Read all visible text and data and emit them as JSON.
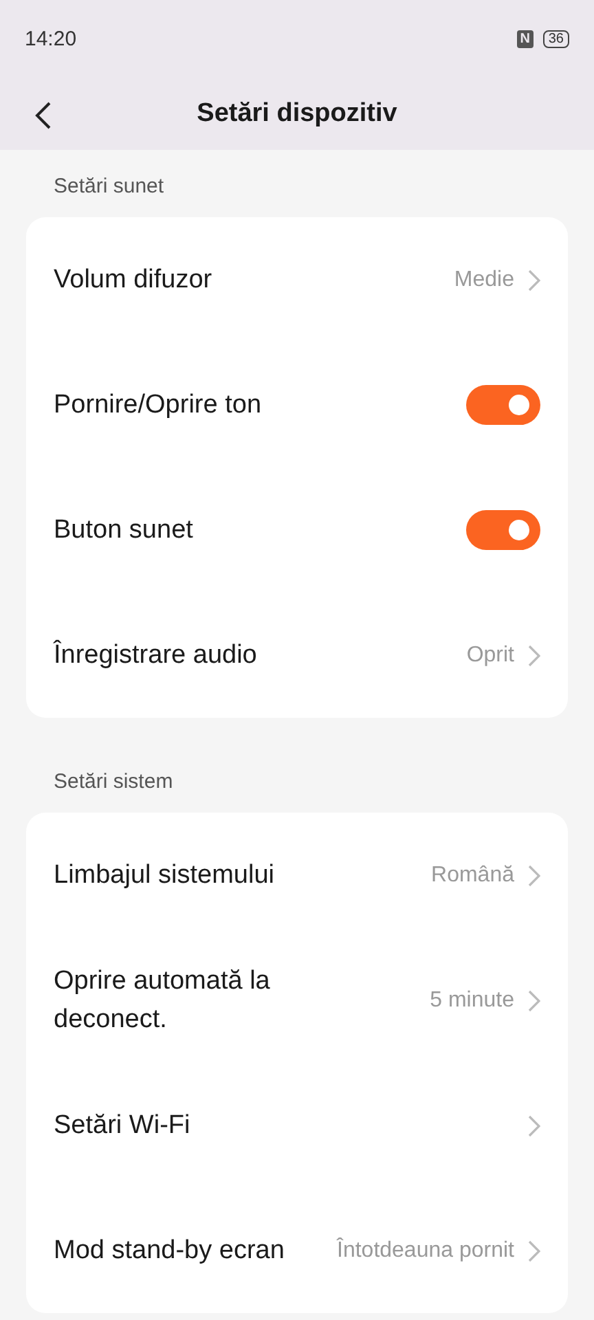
{
  "status_bar": {
    "time": "14:20",
    "nfc": "N",
    "battery": "36"
  },
  "header": {
    "title": "Setări dispozitiv"
  },
  "sections": [
    {
      "title": "Setări sunet",
      "rows": [
        {
          "kind": "value",
          "label": "Volum difuzor",
          "value": "Medie"
        },
        {
          "kind": "toggle",
          "label": "Pornire/Oprire ton",
          "on": true
        },
        {
          "kind": "toggle",
          "label": "Buton sunet",
          "on": true
        },
        {
          "kind": "value",
          "label": "Înregistrare audio",
          "value": "Oprit"
        }
      ]
    },
    {
      "title": "Setări sistem",
      "rows": [
        {
          "kind": "value",
          "label": "Limbajul sistemului",
          "value": "Română"
        },
        {
          "kind": "value",
          "label": "Oprire automată la deconect.",
          "value": "5 minute"
        },
        {
          "kind": "link",
          "label": "Setări Wi-Fi"
        },
        {
          "kind": "value",
          "label": "Mod stand-by ecran",
          "value": "Întotdeauna pornit"
        }
      ]
    }
  ]
}
